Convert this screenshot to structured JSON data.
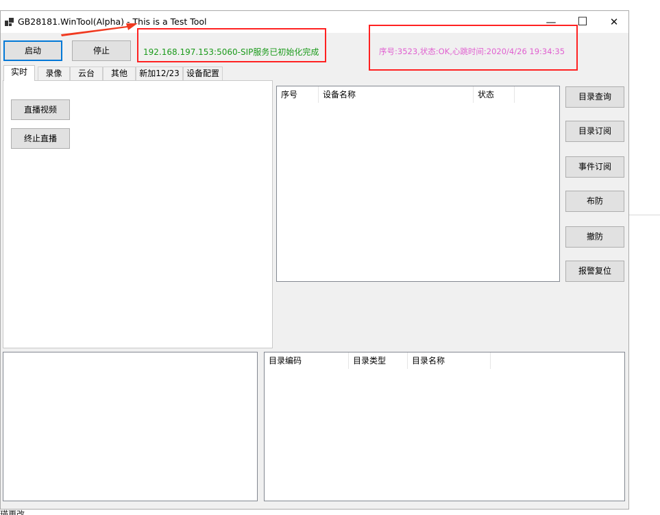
{
  "window": {
    "title": "GB28181.WinTool(Alpha) - This is a Test Tool",
    "controls": {
      "minimize": "—",
      "maximize": "☐",
      "close": "✕"
    }
  },
  "toolbar": {
    "start_label": "启动",
    "stop_label": "停止"
  },
  "status": {
    "sip_message": "192.168.197.153:5060-SIP服务已初始化完成",
    "heartbeat_message": "序号:3523,状态:OK,心跳时间:2020/4/26 19:34:35",
    "colors": {
      "sip": "#1a9a1a",
      "heartbeat": "#e060d0",
      "annotation": "#ff2020"
    }
  },
  "tabs": [
    "实时",
    "录像",
    "云台",
    "其他",
    "新加12/23",
    "设备配置"
  ],
  "live_tab": {
    "play_label": "直播视频",
    "stop_label": "终止直播"
  },
  "device_list": {
    "columns": [
      "序号",
      "设备名称",
      "状态"
    ],
    "rows": []
  },
  "side_buttons": [
    "目录查询",
    "目录订阅",
    "事件订阅",
    "布防",
    "撤防",
    "报警复位"
  ],
  "catalog_list": {
    "columns": [
      "目录编码",
      "目录类型",
      "目录名称"
    ],
    "rows": []
  },
  "background_fragment": "瑛更改"
}
